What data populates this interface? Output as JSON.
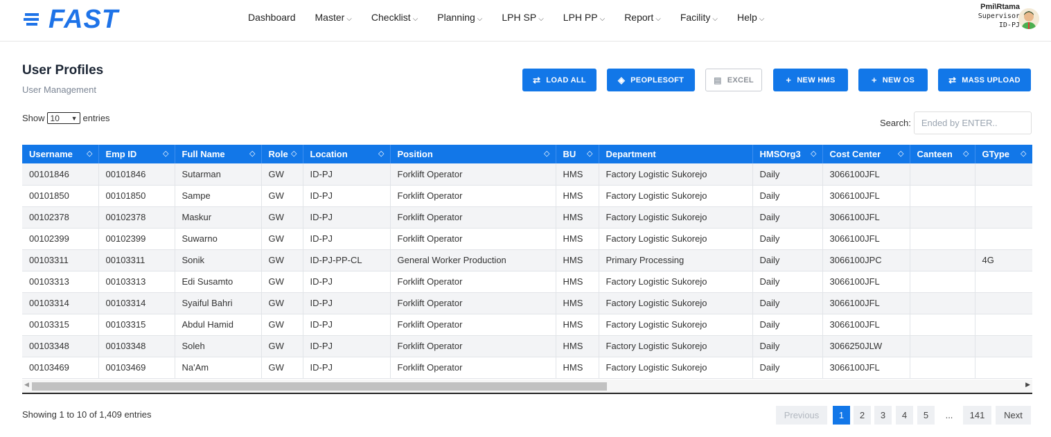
{
  "app": {
    "logo_text": "FAST"
  },
  "nav": [
    {
      "label": "Dashboard",
      "has_menu": false
    },
    {
      "label": "Master",
      "has_menu": true
    },
    {
      "label": "Checklist",
      "has_menu": true
    },
    {
      "label": "Planning",
      "has_menu": true
    },
    {
      "label": "LPH SP",
      "has_menu": true
    },
    {
      "label": "LPH PP",
      "has_menu": true
    },
    {
      "label": "Report",
      "has_menu": true
    },
    {
      "label": "Facility",
      "has_menu": true
    },
    {
      "label": "Help",
      "has_menu": true
    }
  ],
  "user": {
    "name": "Pmi\\Rtama",
    "role": "Supervisor",
    "site": "ID-PJ"
  },
  "page": {
    "title": "User Profiles",
    "subtitle": "User Management"
  },
  "toolbar": {
    "load_all": "LOAD ALL",
    "peoplesoft": "PEOPLESOFT",
    "excel": "EXCEL",
    "new_hms": "NEW HMS",
    "new_os": "NEW OS",
    "mass_upload": "MASS UPLOAD"
  },
  "length": {
    "show_label": "Show",
    "value": "10",
    "entries_label": "entries"
  },
  "search": {
    "label": "Search:",
    "placeholder": "Ended by ENTER.."
  },
  "table": {
    "columns": [
      "Username",
      "Emp ID",
      "Full Name",
      "Role",
      "Location",
      "Position",
      "BU",
      "Department",
      "HMSOrg3",
      "Cost Center",
      "Canteen",
      "GType"
    ],
    "rows": [
      [
        "00101846",
        "00101846",
        "Sutarman",
        "GW",
        "ID-PJ",
        "Forklift Operator",
        "HMS",
        "Factory Logistic Sukorejo",
        "Daily",
        "3066100JFL",
        "",
        ""
      ],
      [
        "00101850",
        "00101850",
        "Sampe",
        "GW",
        "ID-PJ",
        "Forklift Operator",
        "HMS",
        "Factory Logistic Sukorejo",
        "Daily",
        "3066100JFL",
        "",
        ""
      ],
      [
        "00102378",
        "00102378",
        "Maskur",
        "GW",
        "ID-PJ",
        "Forklift Operator",
        "HMS",
        "Factory Logistic Sukorejo",
        "Daily",
        "3066100JFL",
        "",
        ""
      ],
      [
        "00102399",
        "00102399",
        "Suwarno",
        "GW",
        "ID-PJ",
        "Forklift Operator",
        "HMS",
        "Factory Logistic Sukorejo",
        "Daily",
        "3066100JFL",
        "",
        ""
      ],
      [
        "00103311",
        "00103311",
        "Sonik",
        "GW",
        "ID-PJ-PP-CL",
        "General Worker Production",
        "HMS",
        "Primary Processing",
        "Daily",
        "3066100JPC",
        "",
        "4G"
      ],
      [
        "00103313",
        "00103313",
        "Edi Susamto",
        "GW",
        "ID-PJ",
        "Forklift Operator",
        "HMS",
        "Factory Logistic Sukorejo",
        "Daily",
        "3066100JFL",
        "",
        ""
      ],
      [
        "00103314",
        "00103314",
        "Syaiful Bahri",
        "GW",
        "ID-PJ",
        "Forklift Operator",
        "HMS",
        "Factory Logistic Sukorejo",
        "Daily",
        "3066100JFL",
        "",
        ""
      ],
      [
        "00103315",
        "00103315",
        "Abdul Hamid",
        "GW",
        "ID-PJ",
        "Forklift Operator",
        "HMS",
        "Factory Logistic Sukorejo",
        "Daily",
        "3066100JFL",
        "",
        ""
      ],
      [
        "00103348",
        "00103348",
        "Soleh",
        "GW",
        "ID-PJ",
        "Forklift Operator",
        "HMS",
        "Factory Logistic Sukorejo",
        "Daily",
        "3066250JLW",
        "",
        ""
      ],
      [
        "00103469",
        "00103469",
        "Na'Am",
        "GW",
        "ID-PJ",
        "Forklift Operator",
        "HMS",
        "Factory Logistic Sukorejo",
        "Daily",
        "3066100JFL",
        "",
        ""
      ]
    ]
  },
  "footer": {
    "info": "Showing 1 to 10 of 1,409 entries"
  },
  "pagination": {
    "previous": "Previous",
    "pages": [
      "1",
      "2",
      "3",
      "4",
      "5",
      "...",
      "141"
    ],
    "active": "1",
    "next": "Next"
  },
  "colors": {
    "primary": "#1277e8",
    "header_bg": "#1277e8"
  }
}
